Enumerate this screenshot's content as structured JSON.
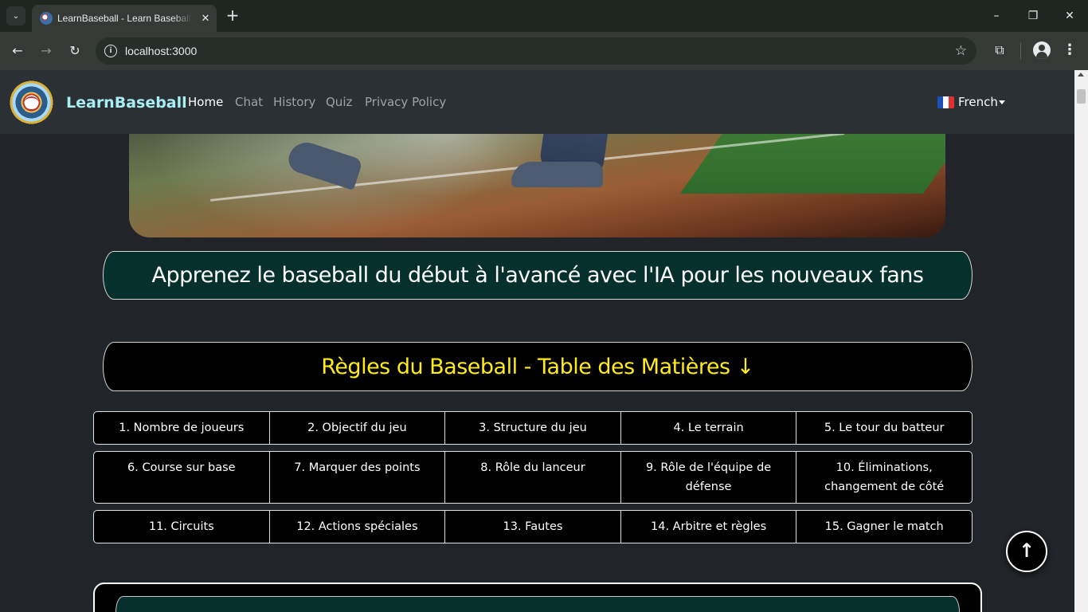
{
  "browser": {
    "tab_title": "LearnBaseball - Learn Baseball from Basics",
    "tab_close": "✕",
    "new_tab": "+",
    "tab_list": "⌄",
    "url": "localhost:3000",
    "window_controls": {
      "minimize": "–",
      "restore": "❐",
      "close": "✕"
    },
    "nav": {
      "back": "←",
      "forward": "→",
      "reload": "↻"
    },
    "icons": {
      "star": "☆",
      "extensions": "⧉",
      "menu": "⋮",
      "info": "i"
    }
  },
  "navbar": {
    "brand": "LearnBaseball",
    "links": [
      "Home",
      "Chat",
      "History",
      "Quiz",
      "Privacy Policy"
    ],
    "active_link": "Home",
    "language": "French"
  },
  "tagline": "Apprenez le baseball du début à l'avancé avec l'IA pour les nouveaux fans",
  "toc": {
    "title": "Règles du Baseball - Table des Matières ↓",
    "rows": [
      [
        "1. Nombre de joueurs",
        "2. Objectif du jeu",
        "3. Structure du jeu",
        "4. Le terrain",
        "5. Le tour du batteur"
      ],
      [
        "6. Course sur base",
        "7. Marquer des points",
        "8. Rôle du lanceur",
        "9. Rôle de l'équipe de défense",
        "10. Éliminations, changement de côté"
      ],
      [
        "11. Circuits",
        "12. Actions spéciales",
        "13. Fautes",
        "14. Arbitre et règles",
        "15. Gagner le match"
      ]
    ]
  },
  "scroll_top_label": "↑",
  "colors": {
    "page_bg": "#212529",
    "navbar_bg": "#2b3035",
    "brand": "#a8eef2",
    "tagline_bg": "#05302c",
    "toc_title": "#ffeb1a"
  }
}
